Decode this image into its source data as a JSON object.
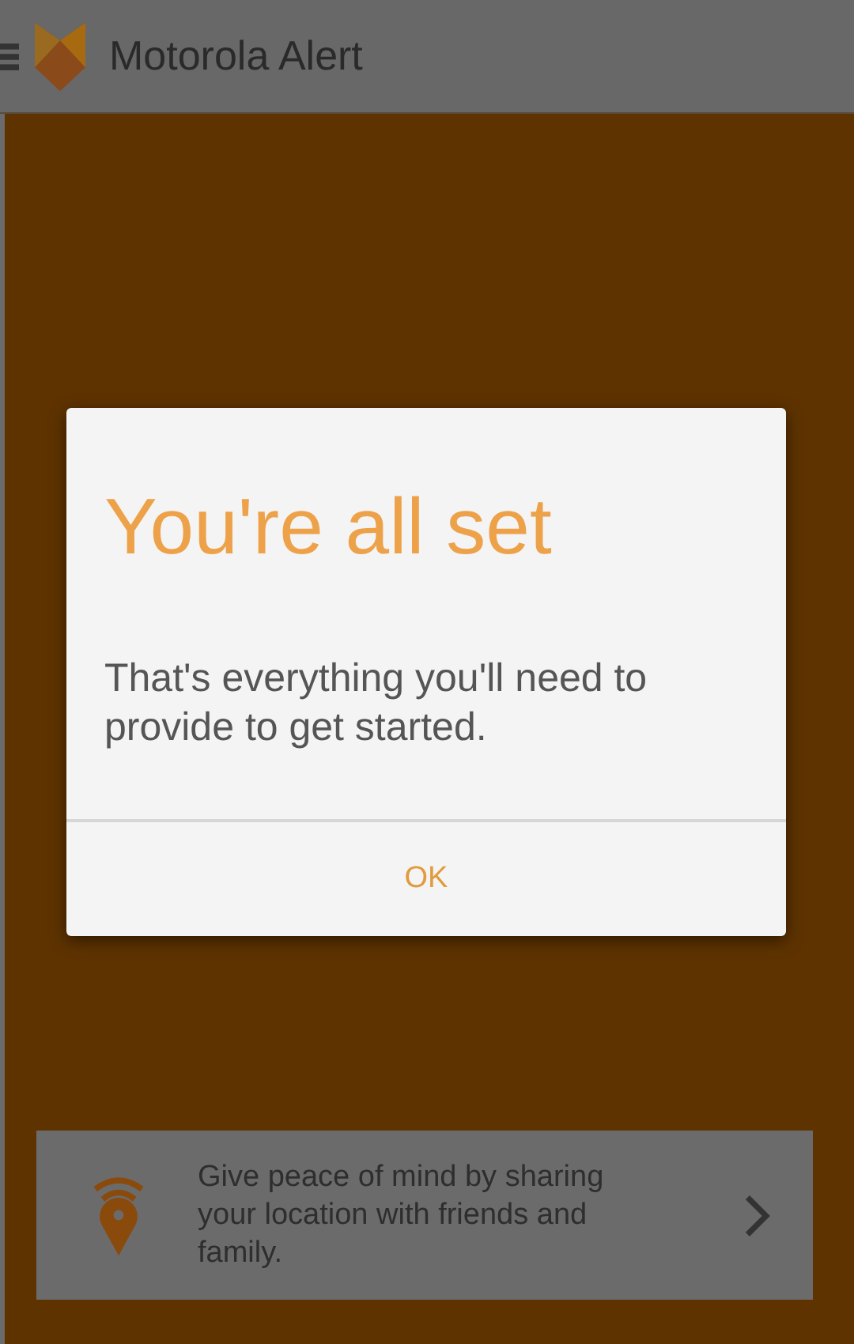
{
  "app_bar": {
    "title": "Motorola Alert"
  },
  "location_card": {
    "text": "Give peace of mind by sharing your location with friends and family."
  },
  "dialog": {
    "title": "You're all set",
    "message": "That's everything you'll need to provide to get started.",
    "button": "OK"
  }
}
